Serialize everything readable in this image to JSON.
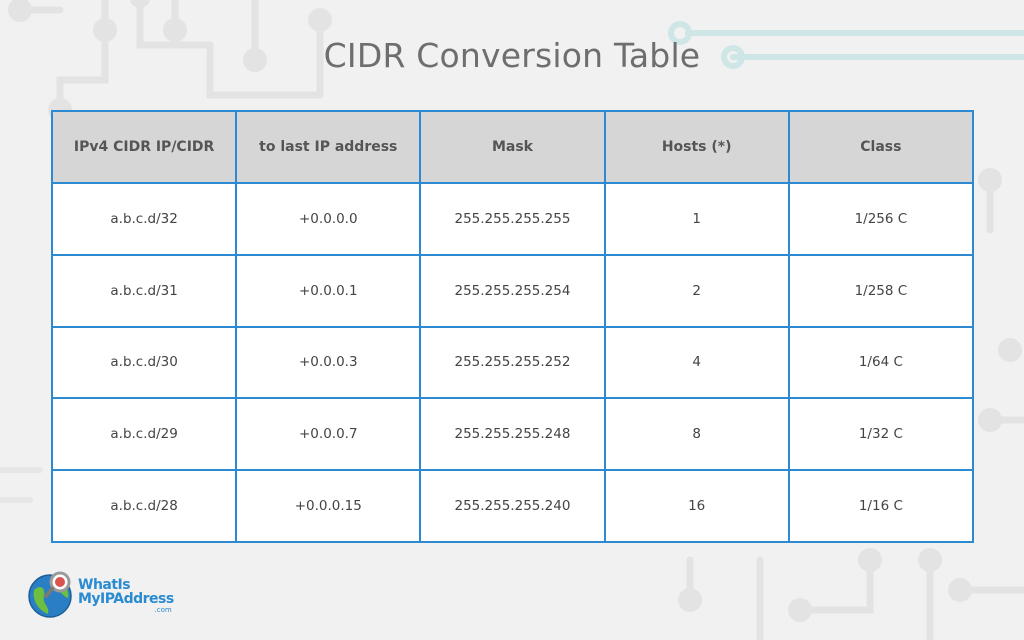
{
  "title": "CIDR Conversion Table",
  "colors": {
    "border": "#2d89d0",
    "header_bg": "#d6d6d6",
    "page_bg": "#f1f1f1",
    "title": "#6e6e6e"
  },
  "table": {
    "headers": [
      "IPv4 CIDR IP/CIDR",
      "to last IP address",
      "Mask",
      "Hosts (*)",
      "Class"
    ],
    "rows": [
      [
        "a.b.c.d/32",
        "+0.0.0.0",
        "255.255.255.255",
        "1",
        "1/256 C"
      ],
      [
        "a.b.c.d/31",
        "+0.0.0.1",
        "255.255.255.254",
        "2",
        "1/258 C"
      ],
      [
        "a.b.c.d/30",
        "+0.0.0.3",
        "255.255.255.252",
        "4",
        "1/64 C"
      ],
      [
        "a.b.c.d/29",
        "+0.0.0.7",
        "255.255.255.248",
        "8",
        "1/32 C"
      ],
      [
        "a.b.c.d/28",
        "+0.0.0.15",
        "255.255.255.240",
        "16",
        "1/16 C"
      ]
    ]
  },
  "logo": {
    "line1": "WhatIs",
    "line2": "MyIPAddress",
    "suffix": ".com",
    "icon": "globe-magnifier-icon"
  }
}
